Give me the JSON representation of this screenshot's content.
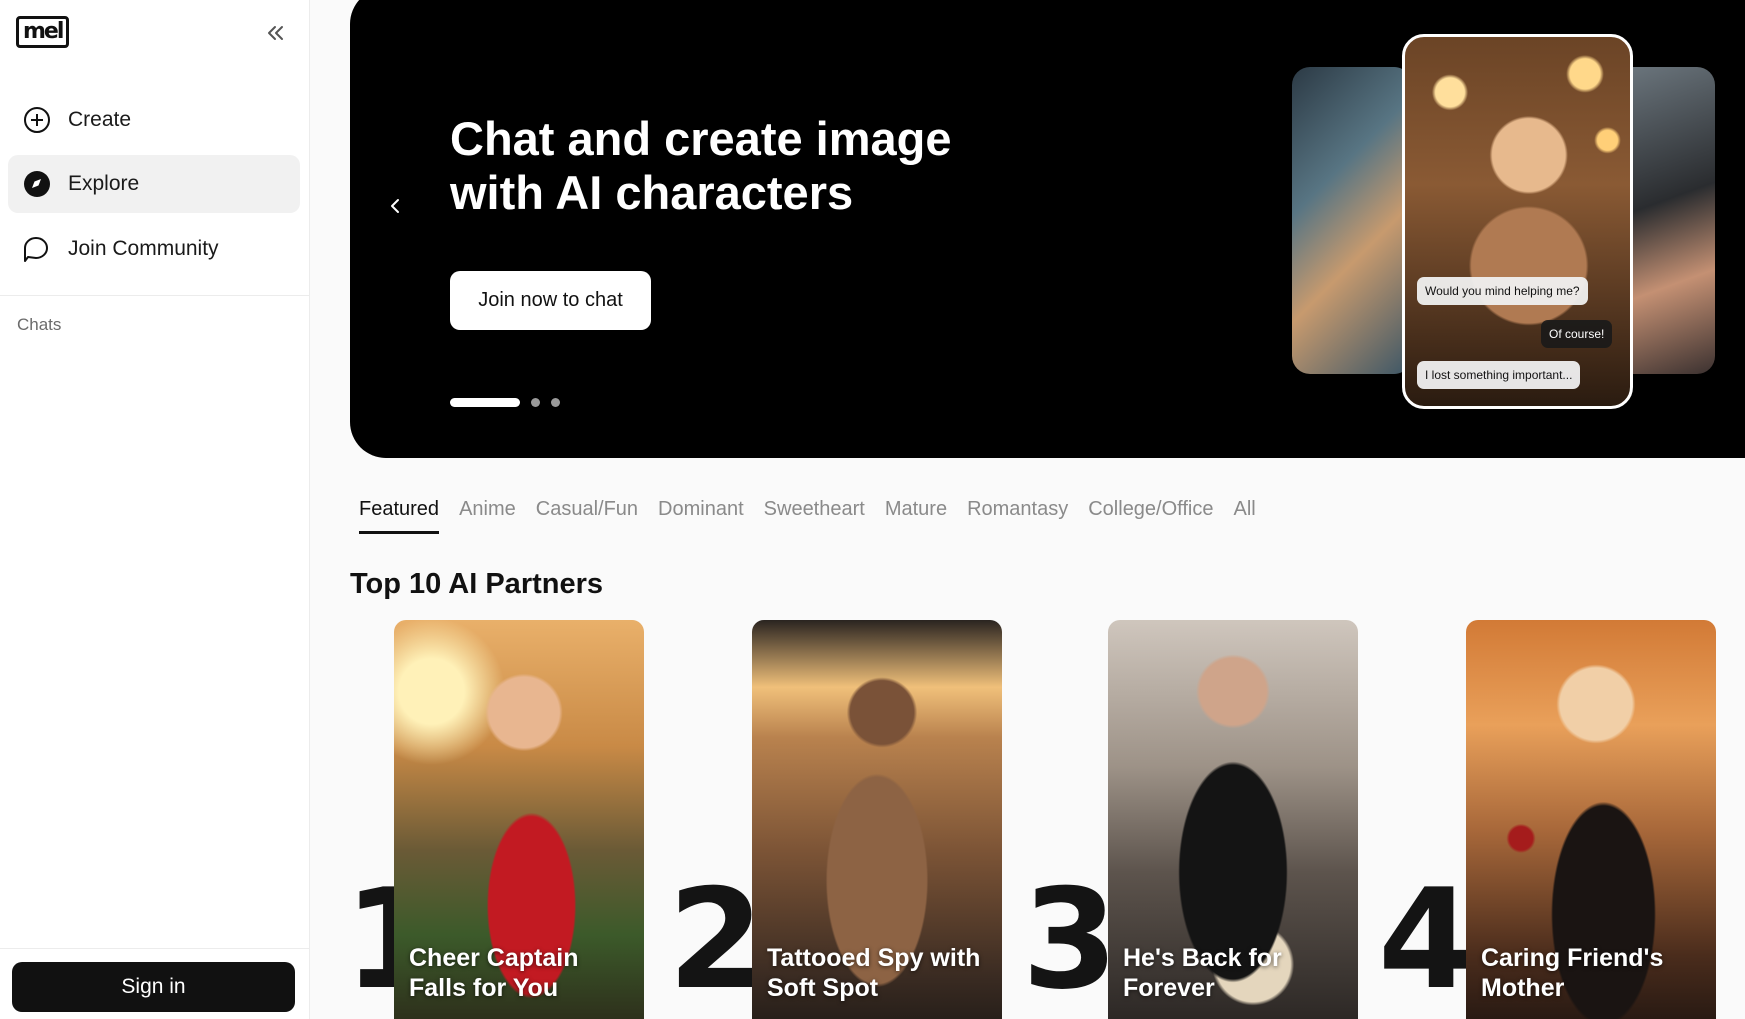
{
  "app": {
    "logo_text": "mel"
  },
  "sidebar": {
    "items": [
      {
        "label": "Create",
        "icon": "plus-circle-icon"
      },
      {
        "label": "Explore",
        "icon": "compass-icon"
      },
      {
        "label": "Join Community",
        "icon": "chat-bubble-icon"
      }
    ],
    "chats_label": "Chats",
    "sign_in_label": "Sign in"
  },
  "hero": {
    "title": "Chat and create image with AI characters",
    "cta_label": "Join now to chat",
    "slide_count": 3,
    "active_slide": 1,
    "bubbles": [
      "Would you mind helping me?",
      "Of course!",
      "I lost something important..."
    ]
  },
  "tabs": [
    "Featured",
    "Anime",
    "Casual/Fun",
    "Dominant",
    "Sweetheart",
    "Mature",
    "Romantasy",
    "College/Office",
    "All"
  ],
  "active_tab": "Featured",
  "section": {
    "title": "Top 10 AI Partners"
  },
  "cards": [
    {
      "rank": "1",
      "title": "Cheer Captain Falls for You"
    },
    {
      "rank": "2",
      "title": "Tattooed Spy with Soft Spot"
    },
    {
      "rank": "3",
      "title": "He's Back for Forever"
    },
    {
      "rank": "4",
      "title": "Caring Friend's Mother"
    }
  ]
}
